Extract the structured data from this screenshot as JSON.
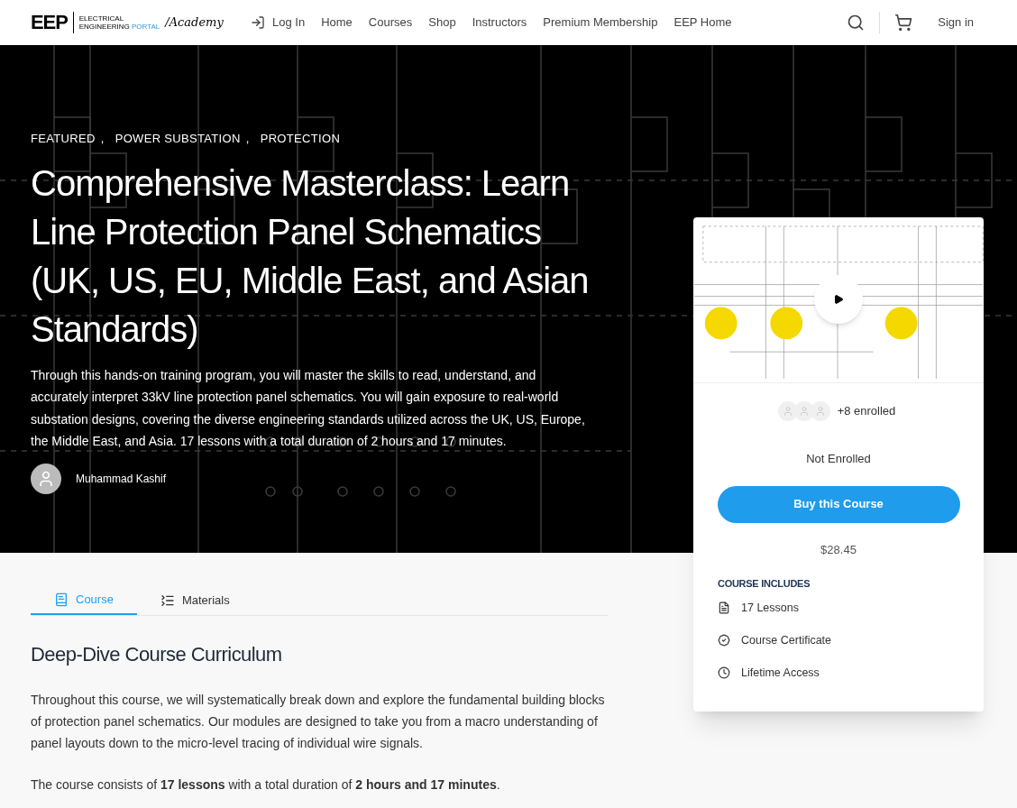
{
  "header": {
    "logo": {
      "mark": "EEP",
      "line1": "ELECTRICAL",
      "line2": "ENGINEERING",
      "line2_accent": "PORTAL",
      "suffix": "/Academy"
    },
    "nav": [
      {
        "label": "Log In",
        "kind": "login"
      },
      {
        "label": "Home",
        "kind": "link"
      },
      {
        "label": "Courses",
        "kind": "link"
      },
      {
        "label": "Shop",
        "kind": "link"
      },
      {
        "label": "Instructors",
        "kind": "link"
      },
      {
        "label": "Premium Membership",
        "kind": "link"
      },
      {
        "label": "EEP Home",
        "kind": "link"
      }
    ],
    "sign_in": "Sign in"
  },
  "hero": {
    "categories": [
      "FEATURED",
      "POWER SUBSTATION",
      "PROTECTION"
    ],
    "separator": ",",
    "title": "Comprehensive Masterclass: Learn Line Protection Panel Schematics (UK, US, EU, Middle East, and Asian Standards)",
    "description": "Through this hands-on training program, you will master the skills to read, understand, and accurately interpret 33kV line protection panel schematics. You will gain exposure to real-world substation designs, covering the diverse engineering standards utilized across the UK, US, Europe, the Middle East, and Asia. 17 lessons with a total duration of 2 hours and 17 minutes.",
    "author": "Muhammad Kashif"
  },
  "card": {
    "enrolled": "+8 enrolled",
    "status": "Not Enrolled",
    "button": "Buy this Course",
    "price": "$28.45",
    "includes_title": "COURSE INCLUDES",
    "includes": [
      {
        "kind": "lessons",
        "label": "17 Lessons"
      },
      {
        "kind": "certificate",
        "label": "Course Certificate"
      },
      {
        "kind": "access",
        "label": "Lifetime Access"
      }
    ]
  },
  "tabs": [
    {
      "label": "Course",
      "kind": "course",
      "selected": true
    },
    {
      "label": "Materials",
      "kind": "materials",
      "selected": false
    }
  ],
  "content": {
    "heading": "Deep-Dive Course Curriculum",
    "paragraphs": [
      "Throughout this course, we will systematically break down and explore the fundamental building blocks of protection panel schematics. Our modules are designed to take you from a macro understanding of panel layouts down to the micro-level tracing of individual wire signals.",
      "The course consists of **17 lessons** with a total duration of **2 hours and 17 minutes**."
    ]
  }
}
